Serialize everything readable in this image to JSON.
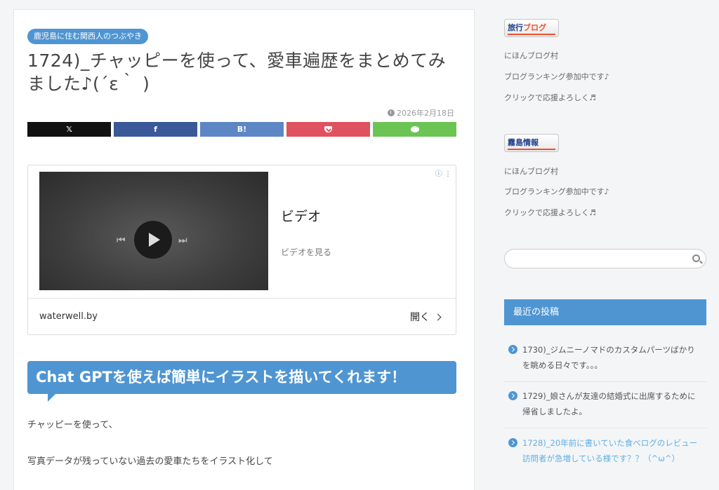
{
  "post": {
    "category": "鹿児島に住む関西人のつぶやき",
    "title": "1724)_チャッピーを使って、愛車遍歴をまとめてみました♪(´ε｀ )",
    "date": "2026年2月18日"
  },
  "share": {
    "x_label": "𝕏",
    "facebook_label": "f",
    "hatena_label": "B!"
  },
  "ad": {
    "headline": "ビデオ",
    "subtext": "ビデオを見る",
    "domain": "waterwell.by",
    "open_label": "開く",
    "info_glyph": "ⓘ ⋮"
  },
  "content": {
    "heading": "Chat GPTを使えば簡単にイラストを描いてくれます！",
    "para1": "チャッピーを使って、",
    "para2": "写真データが残っていない過去の愛車たちをイラスト化して"
  },
  "sidebar": {
    "banner_travel": {
      "part1": "旅行",
      "part2": "ブログ"
    },
    "banner_kiri": {
      "part1": "霧島情報"
    },
    "group1": [
      "にほんブログ村",
      "ブログランキング参加中です♪",
      "クリックで応援よろしく♬"
    ],
    "group2": [
      "にほんブログ村",
      "ブログランキング参加中です♪",
      "クリックで応援よろしく♬"
    ],
    "recent_title": "最近の投稿",
    "recent_posts": [
      "1730)_ジムニーノマドのカスタムパーツばかりを眺める日々です。。。",
      "1729)_娘さんが友達の結婚式に出席するために帰省しましたよ。",
      "1728)_20年前に書いていた食べログのレビュー訪問者が急増している様です？？（^ω^）"
    ]
  },
  "colors": {
    "accent": "#4f95d2",
    "x": "#111111",
    "facebook": "#3b5998",
    "hatena": "#5c87c4",
    "pocket": "#e05260",
    "line": "#6cc454",
    "link_hover": "#5db0e6"
  }
}
